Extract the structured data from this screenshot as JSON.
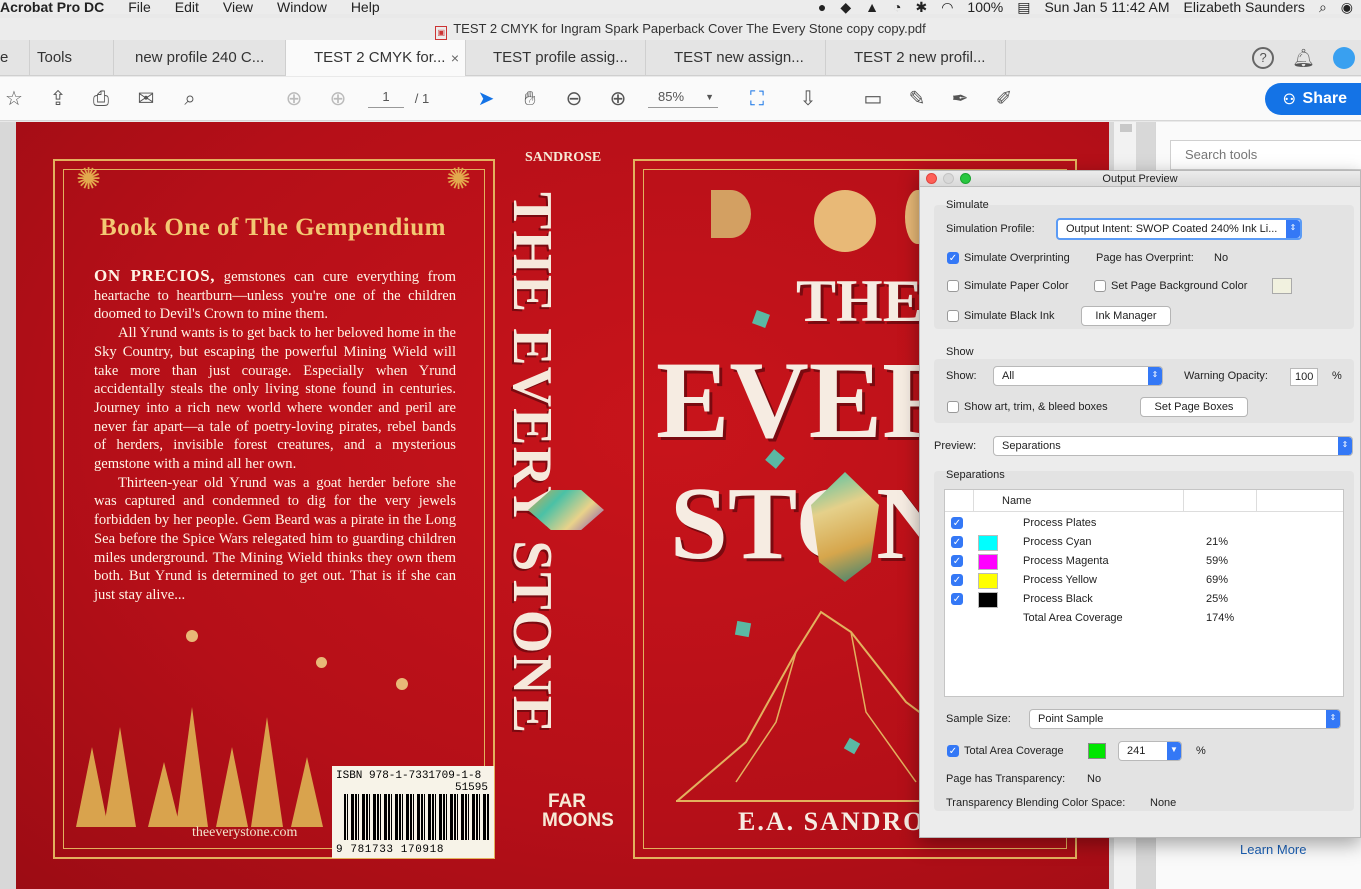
{
  "menubar": {
    "app": "Acrobat Pro DC",
    "items": [
      "File",
      "Edit",
      "View",
      "Window",
      "Help"
    ],
    "battery": "100%",
    "clock": "Sun Jan 5  11:42 AM",
    "user": "Elizabeth Saunders"
  },
  "window_title": "TEST 2 CMYK for Ingram Spark Paperback Cover The Every Stone copy copy.pdf",
  "tabs": {
    "home": "e",
    "tools": "Tools",
    "doc_tabs": [
      "new profile 240 C...",
      "TEST 2 CMYK for...",
      "TEST profile assig...",
      "TEST new assign...",
      "TEST 2 new profil..."
    ],
    "close": "×"
  },
  "toolbar": {
    "page_current": "1",
    "page_total": "/ 1",
    "zoom": "85%",
    "share": "Share"
  },
  "cover": {
    "series": "Book One of The Gempendium",
    "blurb_lead": "ON PRECIOS,",
    "blurb_p1_rest": " gemstones can cure everything from heartache to heartburn—unless you're one of the children doomed to Devil's Crown to mine them.",
    "blurb_p2": "All Yrund wants is to get back to her beloved home in the Sky Country, but escaping the powerful Mining Wield will take more than just courage. Especially when Yrund accidentally steals the only living stone found in centuries. Journey into a rich new world where wonder and peril are never far apart—a tale of poetry-loving pirates, rebel bands of herders, invisible forest creatures, and a mysterious gemstone with a mind all her own.",
    "blurb_p3": "Thirteen-year old Yrund was a goat herder before she was captured and condemned to dig for the very jewels forbidden by her people. Gem Beard was a pirate in the Long Sea before the Spice Wars relegated him to guarding children miles underground. The Mining Wield thinks they own them both. But Yrund is determined to get out. That is if she can just stay alive...",
    "url": "theeverystone.com",
    "isbn": "ISBN 978-1-7331709-1-8",
    "price_code": "51595",
    "barcode_digits": "9 781733 170918",
    "spine_author": "SANDROSE",
    "spine_title": "THE EVERY STONE",
    "publisher_line1": "FAR",
    "publisher_line2": "MOONS",
    "front_the": "THE",
    "front_every": "EVERY",
    "front_stone": "STONE",
    "front_author": "E.A. SANDROSE"
  },
  "right_panel": {
    "search_placeholder": "Search tools",
    "learn_more": "Learn More"
  },
  "output_preview": {
    "title": "Output Preview",
    "simulate_heading": "Simulate",
    "simulation_profile_label": "Simulation Profile:",
    "simulation_profile_value": "Output Intent: SWOP Coated 240% Ink Li...",
    "simulate_overprinting": "Simulate Overprinting",
    "simulate_overprinting_checked": true,
    "page_has_overprint_label": "Page has Overprint:",
    "page_has_overprint_value": "No",
    "simulate_paper_color": "Simulate Paper Color",
    "set_page_bg_color": "Set Page Background Color",
    "simulate_black_ink": "Simulate Black Ink",
    "ink_manager": "Ink Manager",
    "show_heading": "Show",
    "show_label": "Show:",
    "show_value": "All",
    "warning_opacity_label": "Warning Opacity:",
    "warning_opacity_value": "100",
    "percent": "%",
    "show_boxes": "Show art, trim, & bleed boxes",
    "set_page_boxes": "Set Page Boxes",
    "preview_label": "Preview:",
    "preview_value": "Separations",
    "separations_heading": "Separations",
    "col_name": "Name",
    "separations": [
      {
        "name": "Process Plates",
        "value": "",
        "color": ""
      },
      {
        "name": "Process Cyan",
        "value": "21%",
        "color": "#00ffff"
      },
      {
        "name": "Process Magenta",
        "value": "59%",
        "color": "#ff00ff"
      },
      {
        "name": "Process Yellow",
        "value": "69%",
        "color": "#ffff00"
      },
      {
        "name": "Process Black",
        "value": "25%",
        "color": "#000000"
      },
      {
        "name": "Total Area Coverage",
        "value": "174%",
        "color": ""
      }
    ],
    "sample_size_label": "Sample Size:",
    "sample_size_value": "Point Sample",
    "total_area_coverage_label": "Total Area Coverage",
    "total_area_coverage_value": "241",
    "page_has_transparency_label": "Page has Transparency:",
    "page_has_transparency_value": "No",
    "blending_label": "Transparency Blending Color Space:",
    "blending_value": "None"
  }
}
